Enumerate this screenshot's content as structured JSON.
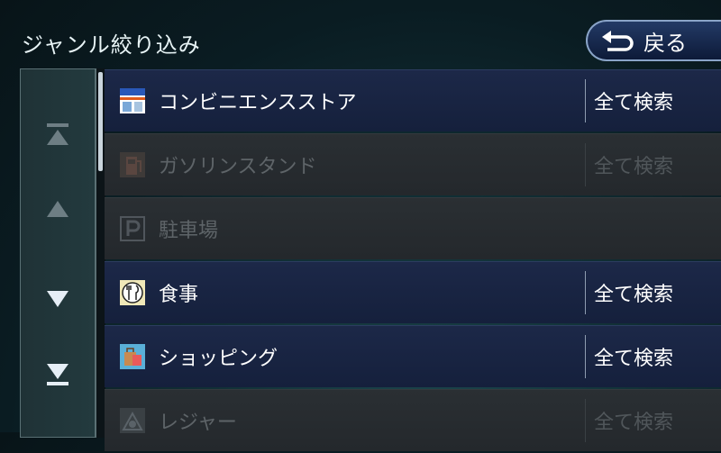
{
  "header": {
    "title": "ジャンル絞り込み",
    "back_label": "戻る"
  },
  "side": {
    "icons": [
      "scroll-to-top-icon",
      "scroll-up-icon",
      "scroll-down-icon",
      "scroll-to-bottom-icon"
    ]
  },
  "list": {
    "items": [
      {
        "label": "コンビニエンスストア",
        "icon": "convenience-store-icon",
        "search": "全て検索",
        "enabled": true
      },
      {
        "label": "ガソリンスタンド",
        "icon": "gas-station-icon",
        "search": "全て検索",
        "enabled": false
      },
      {
        "label": "駐車場",
        "icon": "parking-icon",
        "search": "",
        "enabled": false
      },
      {
        "label": "食事",
        "icon": "restaurant-icon",
        "search": "全て検索",
        "enabled": true
      },
      {
        "label": "ショッピング",
        "icon": "shopping-icon",
        "search": "全て検索",
        "enabled": true
      },
      {
        "label": "レジャー",
        "icon": "leisure-icon",
        "search": "全て検索",
        "enabled": false
      }
    ]
  },
  "colors": {
    "accent": "#8aa4c8",
    "row_active": "#1c2848",
    "row_disabled": "#2a2f33"
  }
}
